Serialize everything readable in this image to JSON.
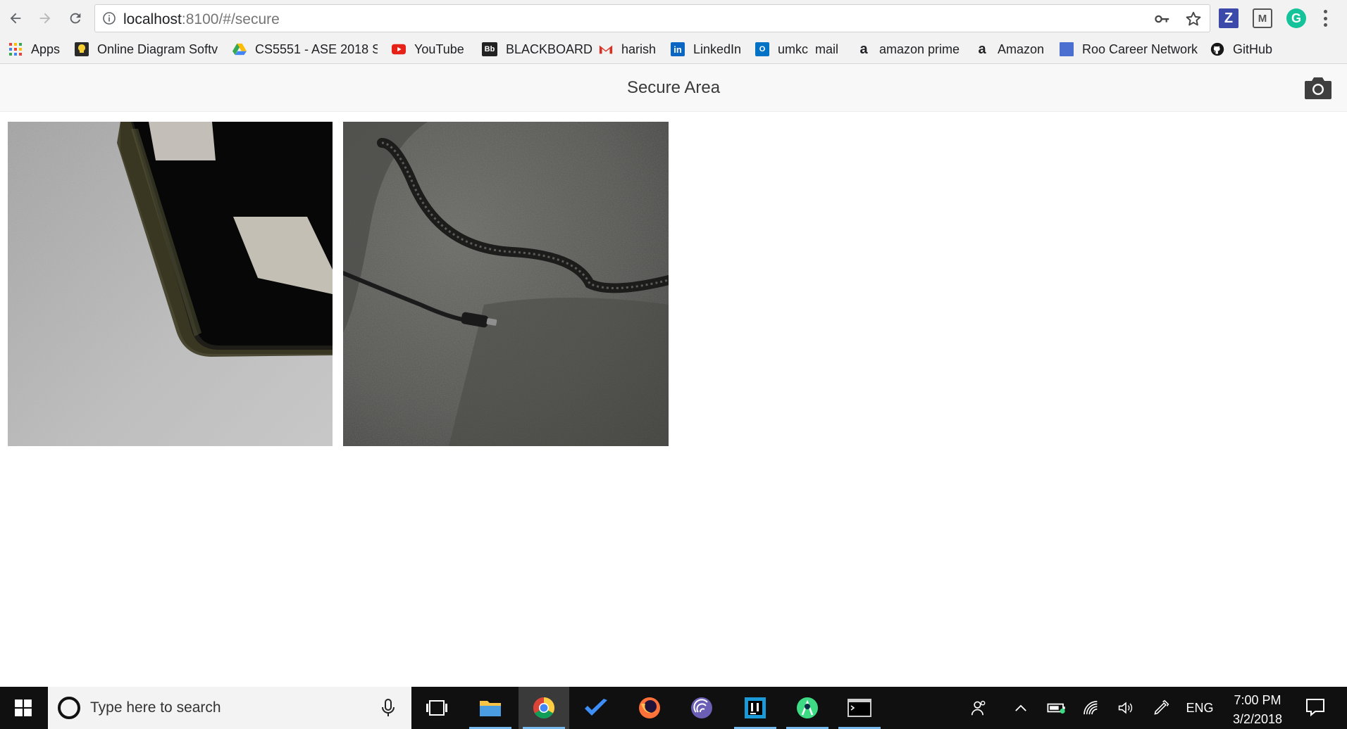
{
  "browser": {
    "url_host": "localhost",
    "url_path": ":8100/#/secure",
    "extensions": [
      {
        "name": "zotero",
        "glyph": "Z"
      },
      {
        "name": "mendeley",
        "glyph": "M"
      },
      {
        "name": "grammarly",
        "glyph": "G"
      }
    ]
  },
  "bookmarks": [
    {
      "label": "Apps",
      "icon": "apps-grid-icon"
    },
    {
      "label": "Online Diagram Softv",
      "icon": "lucidchart-icon"
    },
    {
      "label": "CS5551 - ASE 2018 S",
      "icon": "google-drive-icon"
    },
    {
      "label": "YouTube",
      "icon": "youtube-icon"
    },
    {
      "label": "BLACKBOARD",
      "icon": "blackboard-icon"
    },
    {
      "label": "harish",
      "icon": "gmail-icon"
    },
    {
      "label": "LinkedIn",
      "icon": "linkedin-icon"
    },
    {
      "label": "umkc  mail",
      "icon": "outlook-icon"
    },
    {
      "label": "amazon prime",
      "icon": "amazon-icon"
    },
    {
      "label": "Amazon",
      "icon": "amazon-icon"
    },
    {
      "label": "Roo Career Network",
      "icon": "roo-career-icon"
    },
    {
      "label": "GitHub",
      "icon": "github-icon"
    }
  ],
  "app": {
    "title": "Secure Area",
    "camera_icon": "camera-icon"
  },
  "gallery": [
    {
      "subject": "phone-photo"
    },
    {
      "subject": "bag-cable-photo"
    }
  ],
  "taskbar": {
    "search_placeholder": "Type here to search",
    "apps": [
      "task-view-icon",
      "file-explorer-icon",
      "chrome-icon",
      "todo-icon",
      "firefox-icon",
      "bittorrent-icon",
      "intellij-icon",
      "android-studio-icon",
      "terminal-icon"
    ],
    "language": "ENG",
    "time": "7:00 PM",
    "date": "3/2/2018"
  },
  "colors": {
    "taskbar_bg": "#101010",
    "header_bg": "#f8f8f8",
    "active_underline": "#76b9ed"
  }
}
